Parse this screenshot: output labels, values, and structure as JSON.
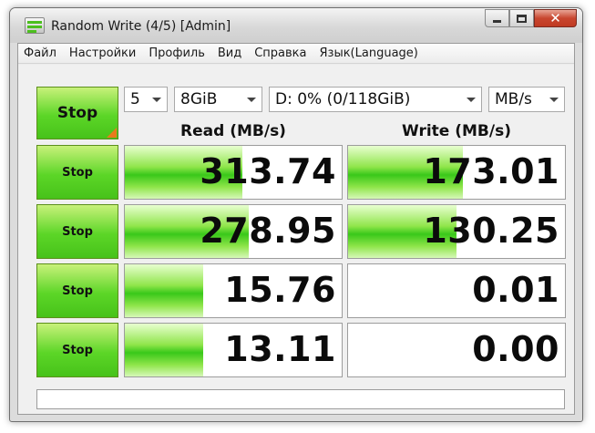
{
  "window": {
    "title": "Random Write (4/5) [Admin]"
  },
  "menu": [
    "Файл",
    "Настройки",
    "Профиль",
    "Вид",
    "Справка",
    "Язык(Language)"
  ],
  "controls": {
    "main_button": "Stop",
    "count": "5",
    "size": "8GiB",
    "drive": "D: 0% (0/118GiB)",
    "unit": "MB/s"
  },
  "headers": {
    "read": "Read (MB/s)",
    "write": "Write (MB/s)"
  },
  "rows": [
    {
      "button": "Stop",
      "read": "313.74",
      "write": "173.01",
      "read_level": 0.54,
      "write_level": 0.53
    },
    {
      "button": "Stop",
      "read": "278.95",
      "write": "130.25",
      "read_level": 0.57,
      "write_level": 0.5
    },
    {
      "button": "Stop",
      "read": "15.76",
      "write": "0.01",
      "read_level": 0.36,
      "write_level": 0.0
    },
    {
      "button": "Stop",
      "read": "13.11",
      "write": "0.00",
      "read_level": 0.36,
      "write_level": 0.0
    }
  ],
  "status": ""
}
